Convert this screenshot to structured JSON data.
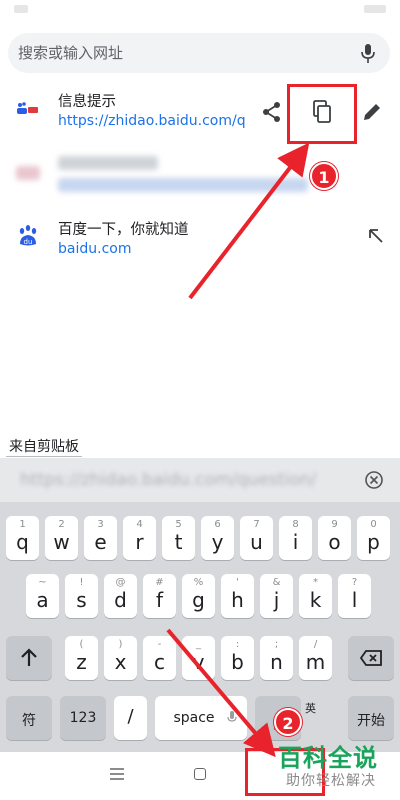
{
  "search": {
    "placeholder": "搜索或输入网址"
  },
  "suggestions": [
    {
      "title": "信息提示",
      "url": "https://zhidao.baidu.com/q"
    },
    {
      "title": "",
      "url": ""
    },
    {
      "title": "百度一下，你就知道",
      "url": "baidu.com"
    }
  ],
  "clipboard": {
    "label": "来自剪贴板",
    "text": "https://zhidao.baidu.com/question/"
  },
  "keyboard": {
    "row1": [
      {
        "main": "q",
        "alt": "1"
      },
      {
        "main": "w",
        "alt": "2"
      },
      {
        "main": "e",
        "alt": "3"
      },
      {
        "main": "r",
        "alt": "4"
      },
      {
        "main": "t",
        "alt": "5"
      },
      {
        "main": "y",
        "alt": "6"
      },
      {
        "main": "u",
        "alt": "7"
      },
      {
        "main": "i",
        "alt": "8"
      },
      {
        "main": "o",
        "alt": "9"
      },
      {
        "main": "p",
        "alt": "0"
      }
    ],
    "row2": [
      {
        "main": "a",
        "alt": "~"
      },
      {
        "main": "s",
        "alt": "!"
      },
      {
        "main": "d",
        "alt": "@"
      },
      {
        "main": "f",
        "alt": "#"
      },
      {
        "main": "g",
        "alt": "%"
      },
      {
        "main": "h",
        "alt": "'"
      },
      {
        "main": "j",
        "alt": "&"
      },
      {
        "main": "k",
        "alt": "*"
      },
      {
        "main": "l",
        "alt": "?"
      }
    ],
    "row3": [
      {
        "main": "z",
        "alt": "("
      },
      {
        "main": "x",
        "alt": ")"
      },
      {
        "main": "c",
        "alt": "-"
      },
      {
        "main": "v",
        "alt": "_"
      },
      {
        "main": "b",
        "alt": ":"
      },
      {
        "main": "n",
        "alt": ";"
      },
      {
        "main": "m",
        "alt": "/"
      }
    ],
    "symbols_key": "符",
    "numbers_key": "123",
    "slash_key": "/",
    "space_key": "space",
    "lang_key_top": "英",
    "lang_key_bottom": "中",
    "enter_key": "开始"
  },
  "annotations": {
    "step1": "1",
    "step2": "2"
  },
  "watermark": {
    "title": "百科全说",
    "subtitle": "助你轻松解决"
  },
  "colors": {
    "accent": "#1a73e8",
    "annotation": "#e8232b",
    "watermark": "#1aa35a"
  }
}
